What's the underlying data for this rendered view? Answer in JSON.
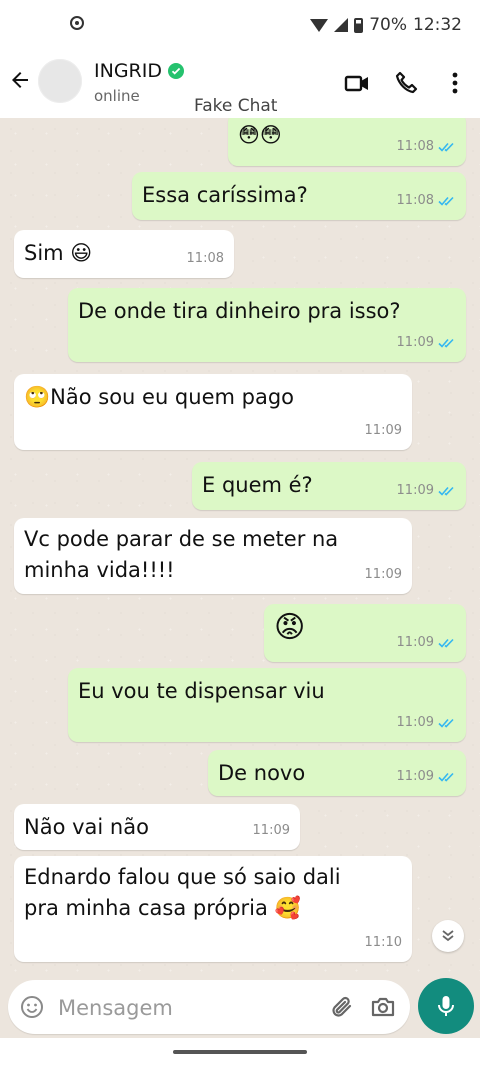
{
  "status_bar": {
    "battery": "70%",
    "time": "12:32"
  },
  "header": {
    "contact_name": "INGRID",
    "contact_status": "online",
    "watermark": "Fake Chat"
  },
  "messages": [
    {
      "dir": "out",
      "text": "😳😳",
      "time": "11:08",
      "read": true
    },
    {
      "dir": "out",
      "text": "Essa caríssima?",
      "time": "11:08",
      "read": true
    },
    {
      "dir": "in",
      "text": "Sim 😃",
      "time": "11:08"
    },
    {
      "dir": "out",
      "text": "De onde tira dinheiro pra isso?",
      "time": "11:09",
      "read": true
    },
    {
      "dir": "in",
      "text": "🙄Não sou eu quem pago",
      "time": "11:09"
    },
    {
      "dir": "out",
      "text": "E quem é?",
      "time": "11:09",
      "read": true
    },
    {
      "dir": "in",
      "text_line1": "Vc pode parar de se meter na",
      "text_line2": "minha vida!!!!",
      "time": "11:09"
    },
    {
      "dir": "out",
      "text": "😡",
      "time": "11:09",
      "read": true
    },
    {
      "dir": "out",
      "text": "Eu vou te dispensar viu",
      "time": "11:09",
      "read": true
    },
    {
      "dir": "out",
      "text": "De novo",
      "time": "11:09",
      "read": true
    },
    {
      "dir": "in",
      "text": "Não vai não",
      "time": "11:09"
    },
    {
      "dir": "in",
      "text_line1": "Ednardo falou que só saio dali",
      "text_line2": "pra minha casa própria 🥰",
      "time": "11:10"
    }
  ],
  "composer": {
    "placeholder": "Mensagem",
    "value": ""
  },
  "colors": {
    "outgoing_bubble": "#dcf8c6",
    "incoming_bubble": "#ffffff",
    "chat_background": "#ece5dd",
    "accent": "#128c7e",
    "read_ticks": "#34b7f1",
    "verified": "#25c26e"
  },
  "icons": [
    "back-arrow-icon",
    "verified-icon",
    "video-call-icon",
    "phone-icon",
    "more-vert-icon",
    "emoji-icon",
    "attach-icon",
    "camera-icon",
    "mic-icon",
    "scroll-down-icon",
    "double-check-icon"
  ]
}
